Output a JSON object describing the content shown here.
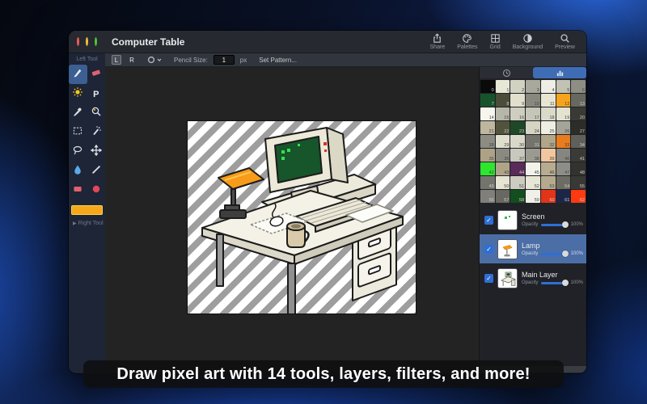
{
  "window": {
    "title": "Computer Table"
  },
  "toolbar": {
    "items": [
      {
        "id": "share",
        "label": "Share"
      },
      {
        "id": "palettes",
        "label": "Palettes"
      },
      {
        "id": "grid",
        "label": "Grid"
      },
      {
        "id": "background",
        "label": "Background"
      },
      {
        "id": "preview",
        "label": "Preview"
      }
    ]
  },
  "subtoolbar": {
    "left_button": "L",
    "right_button": "R",
    "pencil_size_label": "Pencil Size:",
    "pencil_size_value": "1",
    "unit": "px",
    "set_pattern_label": "Set Pattern..."
  },
  "sidebar": {
    "left_tool_label": "Left Tool",
    "right_tool_label": "Right Tool",
    "selected_tool": "pencil",
    "current_color": "#f5a81c",
    "tools": [
      "pencil",
      "eraser",
      "brightness",
      "text",
      "eyedropper",
      "zoom",
      "select-rect",
      "magic-wand",
      "lasso",
      "move",
      "fill",
      "line",
      "rectangle",
      "ellipse"
    ]
  },
  "palette": {
    "selected_tab": "palette",
    "colors": [
      "#0a0a0a",
      "#e9e7d6",
      "#d2d2c2",
      "#a8a89c",
      "#eeeee6",
      "#c2c2b4",
      "#8e8e84",
      "#17542c",
      "#4c4c3a",
      "#e2e0cc",
      "#88887e",
      "#e8e6d2",
      "#f6a41c",
      "#686860",
      "#f6f6ee",
      "#b6b6aa",
      "#cecec0",
      "#c6c6b8",
      "#dadacb",
      "#e4e2d0",
      "#3a3a34",
      "#beb69e",
      "#53523c",
      "#1e4828",
      "#d6d4c2",
      "#efeee2",
      "#a4a498",
      "#2c2c28",
      "#8c8c82",
      "#e0decc",
      "#dad8c8",
      "#74746c",
      "#b2a688",
      "#e87c1e",
      "#60605a",
      "#aea286",
      "#8a8a80",
      "#c8c8bc",
      "#9a9a90",
      "#f2c69e",
      "#868680",
      "#3a3a36",
      "#2ee62e",
      "#b0a488",
      "#5a2a58",
      "#f2f2ea",
      "#b8ac90",
      "#8e8e88",
      "#323230",
      "#74746e",
      "#e6e4d2",
      "#ccccc0",
      "#e8e6d4",
      "#b6aa8e",
      "#6c6c64",
      "#383834",
      "#80807a",
      "#686862",
      "#124e1e",
      "#f0f0e8",
      "#e23418",
      "#1e2648",
      "#ff3a12"
    ]
  },
  "layers": {
    "opacity_label": "Opacity",
    "items": [
      {
        "name": "Screen",
        "opacity": "100%",
        "visible": true,
        "selected": false,
        "thumb": "screen"
      },
      {
        "name": "Lamp",
        "opacity": "100%",
        "visible": true,
        "selected": true,
        "thumb": "lamp"
      },
      {
        "name": "Main Layer",
        "opacity": "100%",
        "visible": true,
        "selected": false,
        "thumb": "main"
      }
    ]
  },
  "caption": {
    "text": "Draw pixel art with 14 tools, layers, filters, and more!"
  },
  "colors": {
    "accent_blue": "#2e6fd4",
    "layer_selection": "#4c6ea6",
    "sidebar_navy": "#1d2536",
    "canvas_bg": "#232323"
  }
}
